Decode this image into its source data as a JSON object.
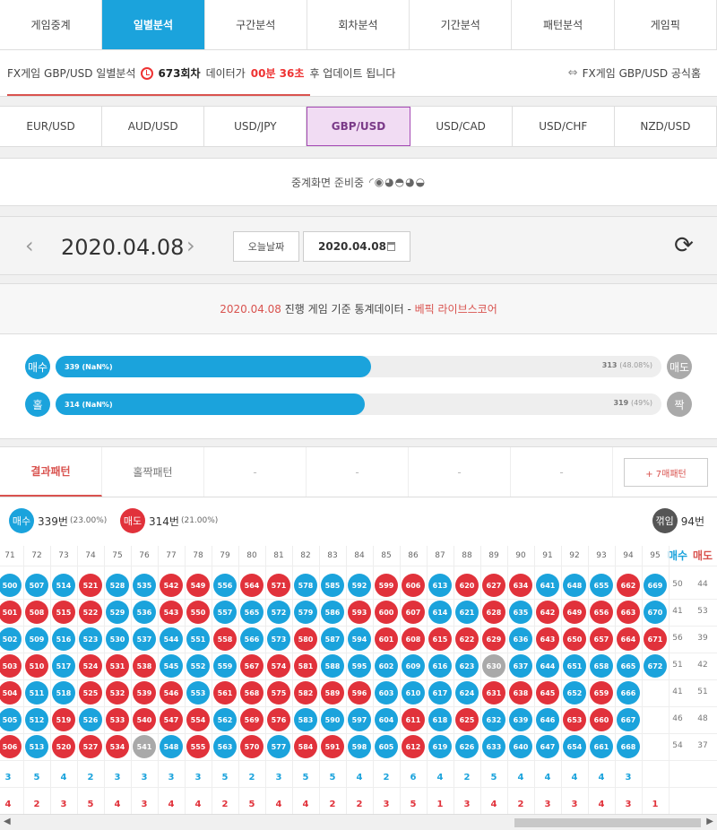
{
  "nav": {
    "tabs": [
      "게임중계",
      "일별분석",
      "구간분석",
      "회차분석",
      "기간분석",
      "패턴분석",
      "게임픽"
    ],
    "active": 1
  },
  "info": {
    "prefix": "FX게임 GBP/USD 일별분석",
    "round": "673회차",
    "data_label": "데이터가",
    "countdown": "00분 36초",
    "suffix": "후 업데이트 됩니다",
    "official_link": "FX게임 GBP/USD 공식홈"
  },
  "pairs": {
    "items": [
      "EUR/USD",
      "AUD/USD",
      "USD/JPY",
      "GBP/USD",
      "USD/CAD",
      "USD/CHF",
      "NZD/USD"
    ],
    "active": 3
  },
  "broadcast": {
    "text": "중계화면 준비중",
    "spinner": "◜◉◕◓◕◒"
  },
  "date": {
    "current": "2020.04.08",
    "today_button": "오늘날짜",
    "field_value": "2020.04.08",
    "prev": "‹",
    "next": "›",
    "refresh": "⟳"
  },
  "stats": {
    "title_date": "2020.04.08",
    "title_mid": "진행 게임 기준 통계데이터 -",
    "title_brand": "베픽 라이브스코어",
    "rows": [
      {
        "left": "매수",
        "right": "매도",
        "left_value": "339 (NaN%)",
        "right_count": "313",
        "right_pct": "(48.08%)",
        "fill": 0.52
      },
      {
        "left": "홀",
        "right": "짝",
        "left_value": "314 (NaN%)",
        "right_count": "319",
        "right_pct": "(49%)",
        "fill": 0.51
      }
    ]
  },
  "pattern": {
    "tabs": [
      "결과패턴",
      "홀짝패턴",
      "-",
      "-",
      "-",
      "-"
    ],
    "seven_button": "+ 7매패턴",
    "legend": {
      "buy_label": "매수",
      "buy_count": "339번",
      "buy_pct": "(23.00%)",
      "sell_label": "매도",
      "sell_count": "314번",
      "sell_pct": "(21.00%)",
      "flip_label": "꺾임",
      "flip_count": "94번"
    },
    "columns": [
      "71",
      "72",
      "73",
      "74",
      "75",
      "76",
      "77",
      "78",
      "79",
      "80",
      "81",
      "82",
      "83",
      "84",
      "85",
      "86",
      "87",
      "88",
      "89",
      "90",
      "91",
      "92",
      "93",
      "94",
      "95"
    ],
    "side_headers": [
      "매수",
      "매도"
    ],
    "rows": [
      {
        "cells": [
          [
            "500",
            "b"
          ],
          [
            "507",
            "b"
          ],
          [
            "514",
            "b"
          ],
          [
            "521",
            "r"
          ],
          [
            "528",
            "b"
          ],
          [
            "535",
            "b"
          ],
          [
            "542",
            "r"
          ],
          [
            "549",
            "r"
          ],
          [
            "556",
            "b"
          ],
          [
            "564",
            "r"
          ],
          [
            "571",
            "r"
          ],
          [
            "578",
            "b"
          ],
          [
            "585",
            "b"
          ],
          [
            "592",
            "b"
          ],
          [
            "599",
            "r"
          ],
          [
            "606",
            "r"
          ],
          [
            "613",
            "b"
          ],
          [
            "620",
            "r"
          ],
          [
            "627",
            "r"
          ],
          [
            "634",
            "r"
          ],
          [
            "641",
            "b"
          ],
          [
            "648",
            "b"
          ],
          [
            "655",
            "b"
          ],
          [
            "662",
            "r"
          ],
          [
            "669",
            "b"
          ]
        ],
        "buy": "50",
        "sell": "44"
      },
      {
        "cells": [
          [
            "501",
            "r"
          ],
          [
            "508",
            "r"
          ],
          [
            "515",
            "r"
          ],
          [
            "522",
            "r"
          ],
          [
            "529",
            "b"
          ],
          [
            "536",
            "b"
          ],
          [
            "543",
            "r"
          ],
          [
            "550",
            "r"
          ],
          [
            "557",
            "b"
          ],
          [
            "565",
            "b"
          ],
          [
            "572",
            "b"
          ],
          [
            "579",
            "b"
          ],
          [
            "586",
            "b"
          ],
          [
            "593",
            "r"
          ],
          [
            "600",
            "r"
          ],
          [
            "607",
            "r"
          ],
          [
            "614",
            "b"
          ],
          [
            "621",
            "b"
          ],
          [
            "628",
            "r"
          ],
          [
            "635",
            "b"
          ],
          [
            "642",
            "r"
          ],
          [
            "649",
            "r"
          ],
          [
            "656",
            "r"
          ],
          [
            "663",
            "r"
          ],
          [
            "670",
            "b"
          ]
        ],
        "buy": "41",
        "sell": "53"
      },
      {
        "cells": [
          [
            "502",
            "b"
          ],
          [
            "509",
            "b"
          ],
          [
            "516",
            "b"
          ],
          [
            "523",
            "b"
          ],
          [
            "530",
            "b"
          ],
          [
            "537",
            "b"
          ],
          [
            "544",
            "b"
          ],
          [
            "551",
            "b"
          ],
          [
            "558",
            "r"
          ],
          [
            "566",
            "b"
          ],
          [
            "573",
            "b"
          ],
          [
            "580",
            "r"
          ],
          [
            "587",
            "b"
          ],
          [
            "594",
            "b"
          ],
          [
            "601",
            "r"
          ],
          [
            "608",
            "r"
          ],
          [
            "615",
            "r"
          ],
          [
            "622",
            "r"
          ],
          [
            "629",
            "r"
          ],
          [
            "636",
            "b"
          ],
          [
            "643",
            "r"
          ],
          [
            "650",
            "r"
          ],
          [
            "657",
            "r"
          ],
          [
            "664",
            "r"
          ],
          [
            "671",
            "r"
          ]
        ],
        "buy": "56",
        "sell": "39"
      },
      {
        "cells": [
          [
            "503",
            "r"
          ],
          [
            "510",
            "r"
          ],
          [
            "517",
            "b"
          ],
          [
            "524",
            "r"
          ],
          [
            "531",
            "r"
          ],
          [
            "538",
            "r"
          ],
          [
            "545",
            "b"
          ],
          [
            "552",
            "b"
          ],
          [
            "559",
            "b"
          ],
          [
            "567",
            "r"
          ],
          [
            "574",
            "r"
          ],
          [
            "581",
            "r"
          ],
          [
            "588",
            "b"
          ],
          [
            "595",
            "b"
          ],
          [
            "602",
            "b"
          ],
          [
            "609",
            "b"
          ],
          [
            "616",
            "b"
          ],
          [
            "623",
            "b"
          ],
          [
            "630",
            "g"
          ],
          [
            "637",
            "b"
          ],
          [
            "644",
            "b"
          ],
          [
            "651",
            "b"
          ],
          [
            "658",
            "b"
          ],
          [
            "665",
            "b"
          ],
          [
            "672",
            "b"
          ]
        ],
        "buy": "51",
        "sell": "42"
      },
      {
        "cells": [
          [
            "504",
            "r"
          ],
          [
            "511",
            "b"
          ],
          [
            "518",
            "b"
          ],
          [
            "525",
            "r"
          ],
          [
            "532",
            "r"
          ],
          [
            "539",
            "r"
          ],
          [
            "546",
            "r"
          ],
          [
            "553",
            "b"
          ],
          [
            "561",
            "r"
          ],
          [
            "568",
            "r"
          ],
          [
            "575",
            "r"
          ],
          [
            "582",
            "r"
          ],
          [
            "589",
            "r"
          ],
          [
            "596",
            "r"
          ],
          [
            "603",
            "b"
          ],
          [
            "610",
            "b"
          ],
          [
            "617",
            "b"
          ],
          [
            "624",
            "b"
          ],
          [
            "631",
            "r"
          ],
          [
            "638",
            "r"
          ],
          [
            "645",
            "r"
          ],
          [
            "652",
            "b"
          ],
          [
            "659",
            "r"
          ],
          [
            "666",
            "b"
          ],
          null
        ],
        "buy": "41",
        "sell": "51"
      },
      {
        "cells": [
          [
            "505",
            "b"
          ],
          [
            "512",
            "b"
          ],
          [
            "519",
            "r"
          ],
          [
            "526",
            "b"
          ],
          [
            "533",
            "r"
          ],
          [
            "540",
            "r"
          ],
          [
            "547",
            "r"
          ],
          [
            "554",
            "r"
          ],
          [
            "562",
            "b"
          ],
          [
            "569",
            "r"
          ],
          [
            "576",
            "r"
          ],
          [
            "583",
            "b"
          ],
          [
            "590",
            "b"
          ],
          [
            "597",
            "b"
          ],
          [
            "604",
            "b"
          ],
          [
            "611",
            "r"
          ],
          [
            "618",
            "b"
          ],
          [
            "625",
            "r"
          ],
          [
            "632",
            "b"
          ],
          [
            "639",
            "b"
          ],
          [
            "646",
            "b"
          ],
          [
            "653",
            "r"
          ],
          [
            "660",
            "r"
          ],
          [
            "667",
            "b"
          ],
          null
        ],
        "buy": "46",
        "sell": "48"
      },
      {
        "cells": [
          [
            "506",
            "r"
          ],
          [
            "513",
            "b"
          ],
          [
            "520",
            "r"
          ],
          [
            "527",
            "r"
          ],
          [
            "534",
            "r"
          ],
          [
            "541",
            "g"
          ],
          [
            "548",
            "b"
          ],
          [
            "555",
            "r"
          ],
          [
            "563",
            "b"
          ],
          [
            "570",
            "r"
          ],
          [
            "577",
            "b"
          ],
          [
            "584",
            "r"
          ],
          [
            "591",
            "r"
          ],
          [
            "598",
            "b"
          ],
          [
            "605",
            "b"
          ],
          [
            "612",
            "r"
          ],
          [
            "619",
            "b"
          ],
          [
            "626",
            "b"
          ],
          [
            "633",
            "b"
          ],
          [
            "640",
            "b"
          ],
          [
            "647",
            "b"
          ],
          [
            "654",
            "b"
          ],
          [
            "661",
            "b"
          ],
          [
            "668",
            "b"
          ],
          null
        ],
        "buy": "54",
        "sell": "37"
      }
    ],
    "sum_blue": [
      "3",
      "5",
      "4",
      "2",
      "3",
      "3",
      "3",
      "3",
      "5",
      "2",
      "3",
      "5",
      "5",
      "4",
      "2",
      "6",
      "4",
      "2",
      "5",
      "4",
      "4",
      "4",
      "4",
      "3"
    ],
    "sum_red": [
      "4",
      "2",
      "3",
      "5",
      "4",
      "3",
      "4",
      "4",
      "2",
      "5",
      "4",
      "4",
      "2",
      "2",
      "3",
      "5",
      "1",
      "3",
      "4",
      "2",
      "3",
      "3",
      "4",
      "3",
      "1"
    ]
  },
  "colors": {
    "accent_blue": "#1ba3dc",
    "accent_red": "#e1323b",
    "neutral_gray": "#a9a9a9"
  }
}
